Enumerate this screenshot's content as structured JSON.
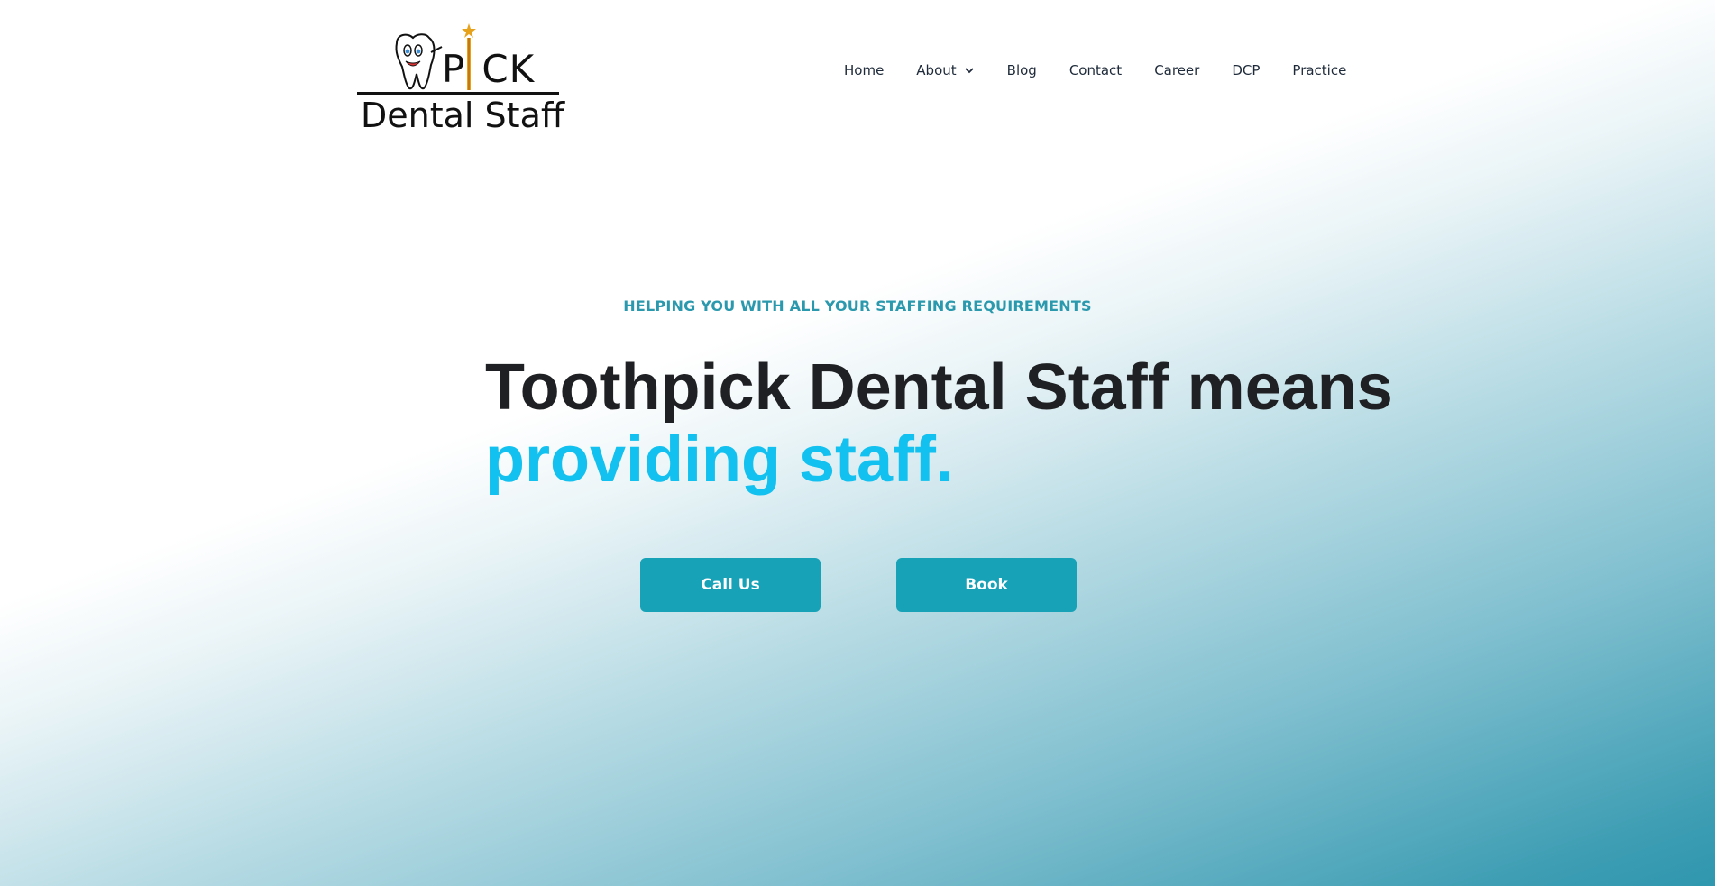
{
  "brand": {
    "logo_top": "P",
    "logo_top_rest": "CK",
    "logo_sub": "Dental Staff",
    "accent_color": "#17a2b8",
    "highlight_color": "#12c1ef"
  },
  "nav": {
    "items": [
      {
        "label": "Home"
      },
      {
        "label": "About",
        "has_dropdown": true,
        "icon": "chevron-down-icon"
      },
      {
        "label": "Blog"
      },
      {
        "label": "Contact"
      },
      {
        "label": "Career"
      },
      {
        "label": "DCP"
      },
      {
        "label": "Practice"
      }
    ]
  },
  "hero": {
    "tagline": "HELPING YOU WITH ALL YOUR STAFFING REQUIREMENTS",
    "title_line1": "Toothpick Dental Staff means",
    "title_line2": "providing staff.",
    "buttons": {
      "call_label": "Call Us",
      "book_label": "Book"
    }
  }
}
